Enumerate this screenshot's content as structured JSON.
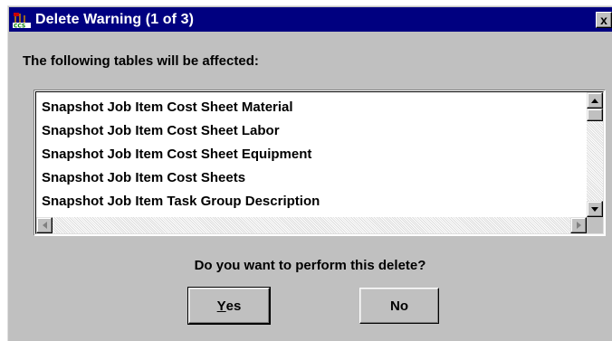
{
  "window": {
    "title": "Delete Warning (1 of 3)",
    "app_icon": "ccs-app-icon",
    "close_glyph": "x"
  },
  "dialog": {
    "affected_label": "The following tables will be affected:",
    "tables": [
      "Snapshot Job Item Cost Sheet Material",
      "Snapshot Job Item Cost Sheet Labor",
      "Snapshot Job Item Cost Sheet Equipment",
      "Snapshot Job Item Cost Sheets",
      "Snapshot Job Item Task Group Description"
    ],
    "question": "Do you want to perform this delete?",
    "yes_mnemonic": "Y",
    "yes_rest": "es",
    "no_label": "No"
  },
  "colors": {
    "titlebar": "#000080",
    "face": "#c0c0c0"
  }
}
